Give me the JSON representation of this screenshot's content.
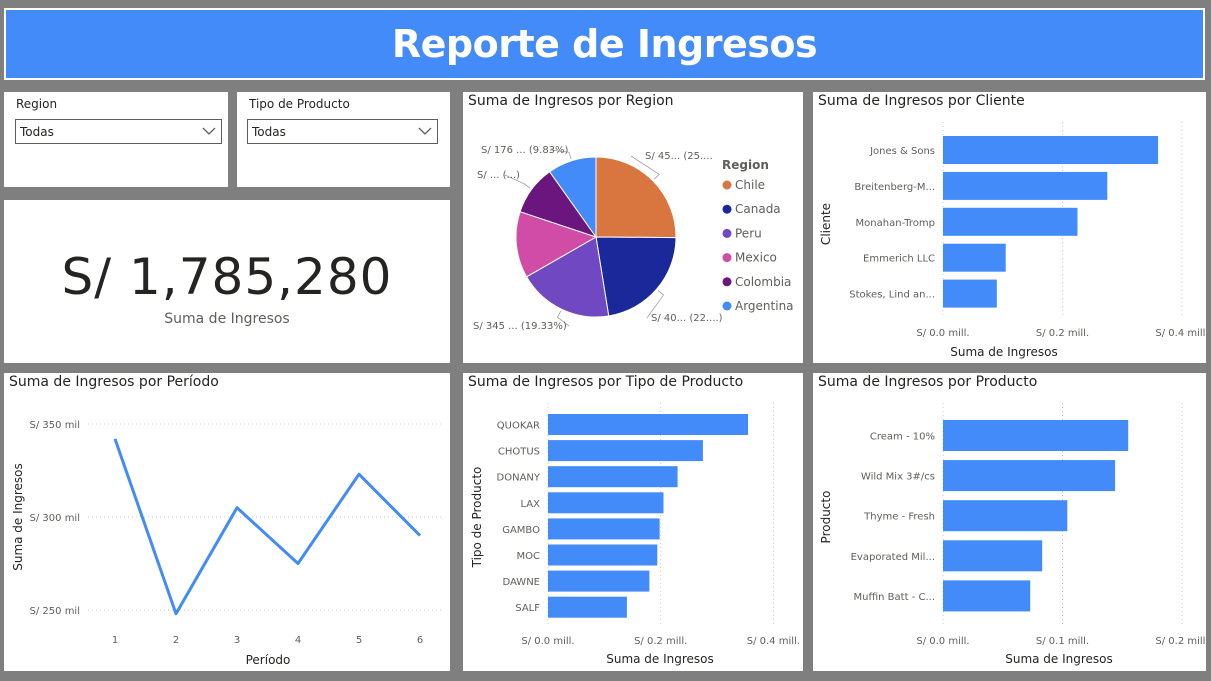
{
  "header": {
    "title": "Reporte de Ingresos"
  },
  "colors": {
    "accent": "#428bf9",
    "background": "#7f7f7f"
  },
  "slicers": [
    {
      "label": "Region",
      "value": "Todas",
      "icon": "chevron-down-icon"
    },
    {
      "label": "Tipo de Producto",
      "value": "Todas",
      "icon": "chevron-down-icon"
    }
  ],
  "kpi": {
    "value": "S/ 1,785,280",
    "label": "Suma de Ingresos"
  },
  "pie": {
    "title": "Suma de Ingresos por Region",
    "legend_title": "Region",
    "slice_labels": [
      "S/ 45... (25....",
      "S/ 40... (22....)",
      "S/ 345 ... (19.33%)",
      "",
      "S/ ... (...)",
      "S/ 176 ... (9.83%)"
    ]
  },
  "cliente": {
    "title": "Suma de Ingresos por Cliente",
    "xlabel": "Suma de Ingresos",
    "ylabel": "Cliente"
  },
  "periodo": {
    "title": "Suma de Ingresos por Período",
    "xlabel": "Período",
    "ylabel": "Suma de Ingresos"
  },
  "tipo": {
    "title": "Suma de Ingresos por Tipo de Producto",
    "xlabel": "Suma de Ingresos",
    "ylabel": "Tipo de Producto"
  },
  "producto": {
    "title": "Suma de Ingresos por Producto",
    "xlabel": "Suma de Ingresos",
    "ylabel": "Producto"
  },
  "chart_data": [
    {
      "type": "pie",
      "title": "Suma de Ingresos por Region",
      "legend": "right",
      "categories": [
        "Chile",
        "Canada",
        "Peru",
        "Mexico",
        "Colombia",
        "Argentina"
      ],
      "values": [
        450000,
        400000,
        345000,
        240000,
        180000,
        176000
      ],
      "colors": [
        "#d9763f",
        "#1a2899",
        "#7048c2",
        "#d04ca6",
        "#6b167f",
        "#428bf9"
      ]
    },
    {
      "type": "bar",
      "orientation": "horizontal",
      "title": "Suma de Ingresos por Cliente",
      "xlabel": "Suma de Ingresos",
      "ylabel": "Cliente",
      "categories": [
        "Jones & Sons",
        "Breitenberg-M...",
        "Monahan-Tromp",
        "Emmerich LLC",
        "Stokes, Lind an..."
      ],
      "values": [
        0.36,
        0.275,
        0.225,
        0.105,
        0.09
      ],
      "ticks": [
        0,
        0.2,
        0.4
      ],
      "tick_labels": [
        "S/ 0.0 mill.",
        "S/ 0.2 mill.",
        "S/ 0.4 mill."
      ],
      "xlim": [
        0,
        0.41
      ]
    },
    {
      "type": "line",
      "title": "Suma de Ingresos por Período",
      "xlabel": "Período",
      "ylabel": "Suma de Ingresos",
      "x": [
        1,
        2,
        3,
        4,
        5,
        6
      ],
      "y": [
        342000,
        248000,
        305000,
        275000,
        323000,
        290000
      ],
      "ticks": [
        250000,
        300000,
        350000
      ],
      "tick_labels": [
        "S/ 250 mil",
        "S/ 300 mil",
        "S/ 350 mil"
      ],
      "ylim": [
        250000,
        350000
      ]
    },
    {
      "type": "bar",
      "orientation": "horizontal",
      "title": "Suma de Ingresos por Tipo de Producto",
      "xlabel": "Suma de Ingresos",
      "ylabel": "Tipo de Producto",
      "categories": [
        "QUOKAR",
        "CHOTUS",
        "DONANY",
        "LAX",
        "GAMBO",
        "MOC",
        "DAWNE",
        "SALF"
      ],
      "values": [
        0.355,
        0.275,
        0.23,
        0.205,
        0.198,
        0.194,
        0.18,
        0.14
      ],
      "ticks": [
        0,
        0.2,
        0.4
      ],
      "tick_labels": [
        "S/ 0.0 mill.",
        "S/ 0.2 mill.",
        "S/ 0.4 mill."
      ],
      "xlim": [
        0,
        0.41
      ]
    },
    {
      "type": "bar",
      "orientation": "horizontal",
      "title": "Suma de Ingresos por Producto",
      "xlabel": "Suma de Ingresos",
      "ylabel": "Producto",
      "categories": [
        "Cream - 10%",
        "Wild Mix 3#/cs",
        "Thyme - Fresh",
        "Evaporated Mil...",
        "Muffin Batt - C..."
      ],
      "values": [
        0.155,
        0.144,
        0.104,
        0.083,
        0.073
      ],
      "ticks": [
        0,
        0.1,
        0.2
      ],
      "tick_labels": [
        "S/ 0.0 mill.",
        "S/ 0.1 mill.",
        "S/ 0.2 mill."
      ],
      "xlim": [
        0,
        0.205
      ]
    }
  ]
}
